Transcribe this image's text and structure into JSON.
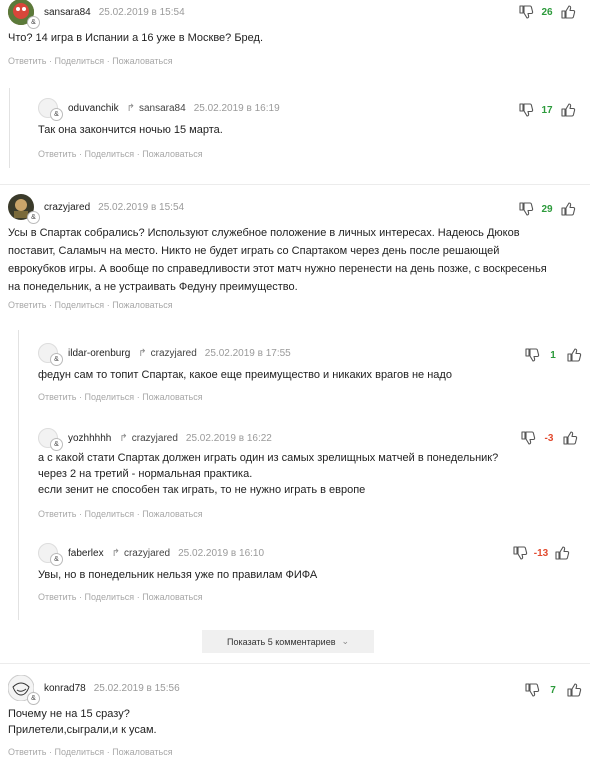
{
  "actions": {
    "reply": "Ответить",
    "share": "Поделиться",
    "report": "Пожаловаться",
    "sep": " · "
  },
  "reply_icon": "reply-arrow-icon",
  "badge_label": "&",
  "comments": [
    {
      "author": "sansara84",
      "reply_to": "",
      "date": "25.02.2019 в 15:54",
      "score": "26",
      "text": [
        "Что? 14 игра в Испании а 16 уже в Москве? Бред."
      ],
      "avatar": "cartoon-red-avatar"
    },
    {
      "author": "oduvanchik",
      "reply_to": "sansara84",
      "date": "25.02.2019 в 16:19",
      "score": "17",
      "text": [
        "Так она закончится ночью 15 марта."
      ],
      "avatar": "blank-avatar"
    },
    {
      "author": "crazyjared",
      "reply_to": "",
      "date": "25.02.2019 в 15:54",
      "score": "29",
      "text": [
        "Усы в Спартак собрались? Используют служебное положение в личных интересах. Надеюсь Дюков",
        "поставит, Саламыч на место. Никто не будет играть со Спартаком через день после решающей",
        "еврокубков игры. А вообще по справедливости этот матч нужно перенести на день позже, с воскресенья",
        "на понедельник, а не устраивать Федуну преимущество."
      ],
      "avatar": "photo-dark-avatar"
    },
    {
      "author": "ildar-orenburg",
      "reply_to": "crazyjared",
      "date": "25.02.2019 в 17:55",
      "score": "1",
      "text": [
        "федун сам то топит Спартак, какое еще преимущество и никаких врагов не надо"
      ],
      "avatar": "blank-avatar"
    },
    {
      "author": "yozhhhhh",
      "reply_to": "crazyjared",
      "date": "25.02.2019 в 16:22",
      "score": "-3",
      "text": [
        "а с какой стати Спартак должен играть один из самых зрелищных матчей в понедельник?",
        "через 2 на третий - нормальная практика.",
        "если зенит не способен так играть, то не нужно играть в европе"
      ],
      "avatar": "blank-avatar"
    },
    {
      "author": "faberlex",
      "reply_to": "crazyjared",
      "date": "25.02.2019 в 16:10",
      "score": "-13",
      "text": [
        "Увы, но в понедельник нельзя уже по правилам ФИФА"
      ],
      "avatar": "blank-avatar"
    },
    {
      "author": "konrad78",
      "reply_to": "",
      "date": "25.02.2019 в 15:56",
      "score": "7",
      "text": [
        "Почему не на 15 сразу?",
        "Прилетели,сыграли,и к усам."
      ],
      "avatar": "troll-face-avatar"
    }
  ],
  "show_more": {
    "label": "Показать 5 комментариев",
    "icon": "chevron-down-icon"
  },
  "colors": {
    "positive": "#2c9a3b",
    "negative": "#e24a2e",
    "meta": "#9a9a9a"
  }
}
